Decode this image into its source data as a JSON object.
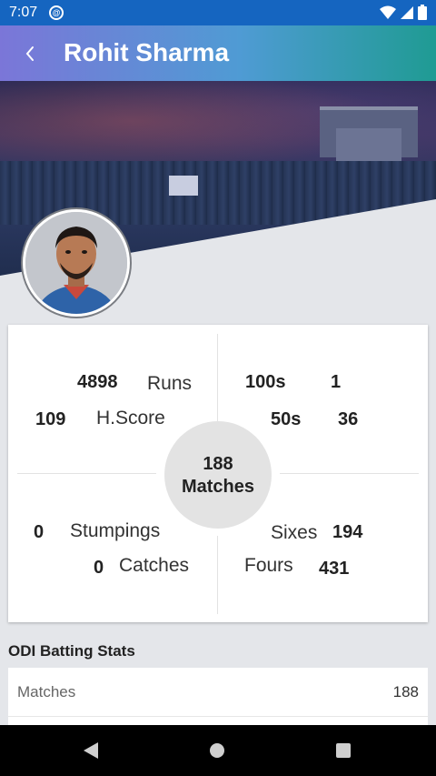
{
  "status_bar": {
    "time": "7:07",
    "app_icon": "sync-app-icon",
    "icons": [
      "wifi-icon",
      "signal-icon",
      "battery-icon"
    ]
  },
  "app_bar": {
    "title": "Rohit Sharma",
    "back_icon": "chevron-left-icon"
  },
  "player": {
    "name": "Rohit Sharma"
  },
  "stats": {
    "runs": {
      "value": "4898",
      "label": "Runs"
    },
    "high_score": {
      "value": "109",
      "label": "H.Score"
    },
    "hundreds": {
      "value": "1",
      "label": "100s"
    },
    "fifties": {
      "value": "36",
      "label": "50s"
    },
    "matches": {
      "value": "188",
      "label": "Matches"
    },
    "stumpings": {
      "value": "0",
      "label": "Stumpings"
    },
    "catches": {
      "value": "0",
      "label": "Catches"
    },
    "sixes": {
      "value": "194",
      "label": "Sixes"
    },
    "fours": {
      "value": "431",
      "label": "Fours"
    }
  },
  "batting_section": {
    "title": "ODI Batting Stats",
    "rows": [
      {
        "label": "Matches",
        "value": "188"
      }
    ]
  },
  "nav": {
    "icons": [
      "back-triangle-icon",
      "home-circle-icon",
      "recents-square-icon"
    ]
  },
  "colors": {
    "status_bar": "#1565c0",
    "app_bar_start": "#7b76d8",
    "app_bar_end": "#1f9b93"
  }
}
